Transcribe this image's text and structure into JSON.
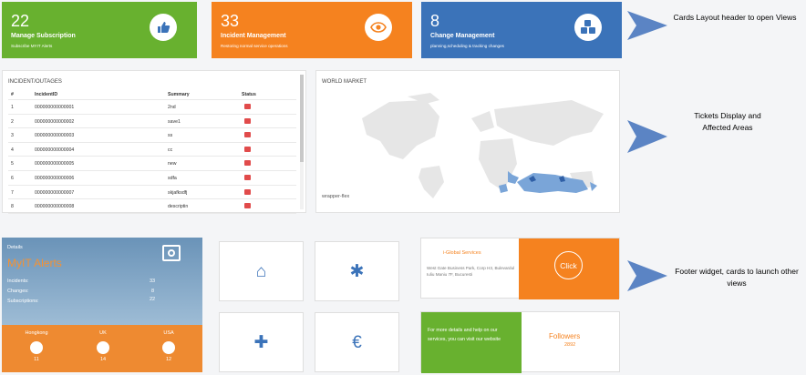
{
  "cards": [
    {
      "number": "22",
      "title": "Manage Subscription",
      "subtitle": "Subscribe MYIT Alerts",
      "icon": "thumbs-up-icon",
      "color": "#68b12f"
    },
    {
      "number": "33",
      "title": "Incident Management",
      "subtitle": "Restoring normal service operations",
      "icon": "eye-icon",
      "color": "#f5821f"
    },
    {
      "number": "8",
      "title": "Change Management",
      "subtitle": "planning,scheduling & tracking changes",
      "icon": "cubes-icon",
      "color": "#3b73b9"
    }
  ],
  "annotations": {
    "header": "Cards Layout header to open Views",
    "tickets": "Tickets Display and Affected Areas",
    "footer": "Footer widget, cards to launch other views"
  },
  "incidents": {
    "title": "INCIDENT/OUTAGES",
    "columns": [
      "#",
      "IncidentID",
      "Summary",
      "Status"
    ],
    "rows": [
      [
        "1",
        "000000000000001",
        "2nd"
      ],
      [
        "2",
        "000000000000002",
        "save1"
      ],
      [
        "3",
        "000000000000003",
        "ss"
      ],
      [
        "4",
        "000000000000004",
        "cc"
      ],
      [
        "5",
        "000000000000005",
        "new"
      ],
      [
        "6",
        "000000000000006",
        "sdfa"
      ],
      [
        "7",
        "000000000000007",
        "skjafksdfj"
      ],
      [
        "8",
        "000000000000008",
        "descriptin"
      ]
    ]
  },
  "world": {
    "title": "WORLD MARKET",
    "footer": "wrapper-flex"
  },
  "details": {
    "label": "Details",
    "title": "MyIT Alerts",
    "stats": [
      {
        "label": "Incidents:",
        "value": "33"
      },
      {
        "label": "Changes:",
        "value": "8"
      },
      {
        "label": "Subscriptions:",
        "value": "22"
      }
    ],
    "locations": [
      {
        "name": "Hongkong",
        "value": "11"
      },
      {
        "name": "UK",
        "value": "14"
      },
      {
        "name": "USA",
        "value": "12"
      }
    ]
  },
  "tiles": [
    {
      "name": "home-icon",
      "glyph": "⌂"
    },
    {
      "name": "asterisk-icon",
      "glyph": "✱"
    },
    {
      "name": "plus-icon",
      "glyph": "✚"
    },
    {
      "name": "euro-icon",
      "glyph": "€"
    }
  ],
  "global": {
    "title": "i-Global Services",
    "address": "West Gate Business Park, Corp H3, Bulevardul Iuliu Maniu 7F, Bucuresti",
    "button": "Click"
  },
  "more": {
    "text": "For more details and help on our services, you can visit our website",
    "followers_label": "Followers",
    "followers_value": "2892"
  }
}
